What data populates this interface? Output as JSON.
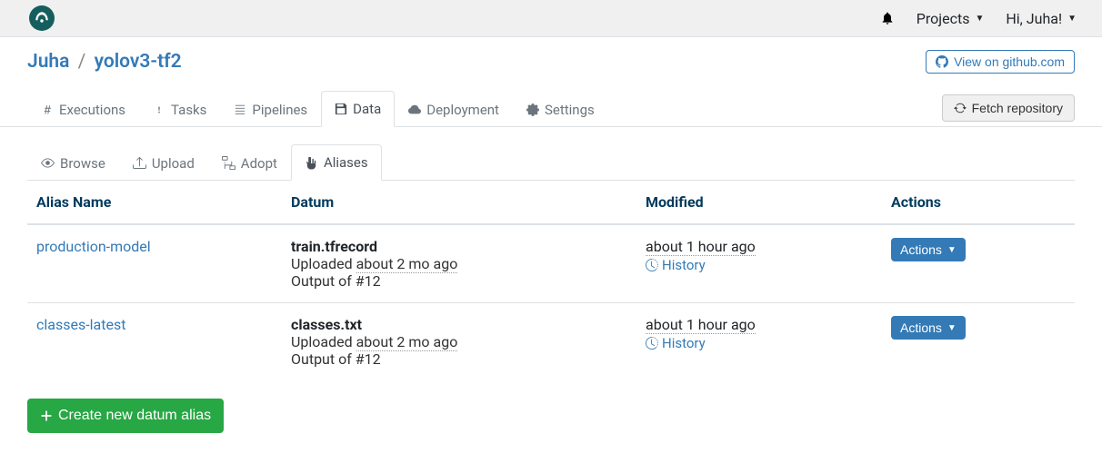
{
  "topbar": {
    "projects_label": "Projects",
    "greeting": "Hi, Juha!"
  },
  "breadcrumb": {
    "owner": "Juha",
    "project": "yolov3-tf2",
    "github_label": "View on github.com"
  },
  "tabs": {
    "executions": "Executions",
    "tasks": "Tasks",
    "pipelines": "Pipelines",
    "data": "Data",
    "deployment": "Deployment",
    "settings": "Settings",
    "fetch_label": "Fetch repository"
  },
  "subtabs": {
    "browse": "Browse",
    "upload": "Upload",
    "adopt": "Adopt",
    "aliases": "Aliases"
  },
  "table": {
    "headers": {
      "alias": "Alias Name",
      "datum": "Datum",
      "modified": "Modified",
      "actions": "Actions"
    },
    "rows": [
      {
        "alias": "production-model",
        "datum_name": "train.tfrecord",
        "uploaded_prefix": "Uploaded ",
        "uploaded_ago": "about 2 mo ago",
        "output_of": "Output of #12",
        "modified": "about 1 hour ago",
        "history": "History",
        "actions_label": "Actions"
      },
      {
        "alias": "classes-latest",
        "datum_name": "classes.txt",
        "uploaded_prefix": "Uploaded ",
        "uploaded_ago": "about 2 mo ago",
        "output_of": "Output of #12",
        "modified": "about 1 hour ago",
        "history": "History",
        "actions_label": "Actions"
      }
    ]
  },
  "create_button": "Create new datum alias"
}
